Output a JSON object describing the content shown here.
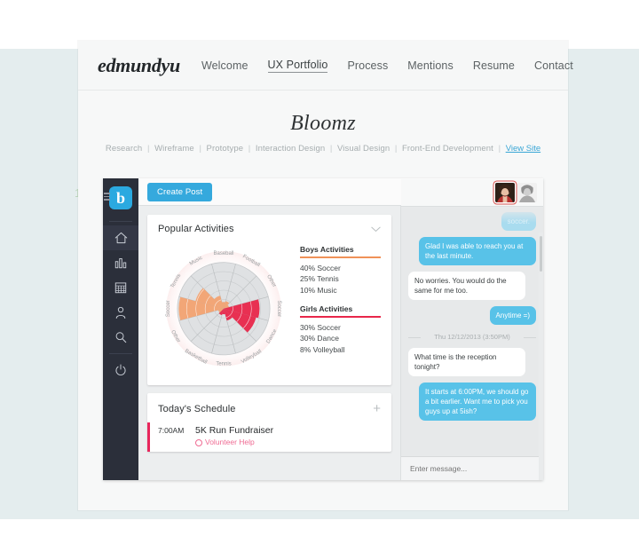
{
  "site": {
    "brand": "edmundyu",
    "nav": [
      {
        "label": "Welcome",
        "active": false
      },
      {
        "label": "UX Portfolio",
        "active": true
      },
      {
        "label": "Process",
        "active": false
      },
      {
        "label": "Mentions",
        "active": false
      },
      {
        "label": "Resume",
        "active": false
      },
      {
        "label": "Contact",
        "active": false
      }
    ]
  },
  "project": {
    "title": "Bloomz",
    "tags": [
      "Research",
      "Wireframe",
      "Prototype",
      "Interaction Design",
      "Visual Design",
      "Front-End Development"
    ],
    "separator": "|",
    "view_site_label": "View Site"
  },
  "marker": {
    "number": "1"
  },
  "app": {
    "sidebar": {
      "logo_letter": "b",
      "items": [
        {
          "icon": "home-icon",
          "selected": true
        },
        {
          "icon": "bar-chart-icon",
          "selected": false
        },
        {
          "icon": "calendar-icon",
          "selected": false
        },
        {
          "icon": "person-icon",
          "selected": false
        },
        {
          "icon": "search-icon",
          "selected": false
        },
        {
          "icon": "power-icon",
          "selected": false
        }
      ]
    },
    "toolbar": {
      "create_post_label": "Create Post"
    },
    "cards": {
      "activities": {
        "title": "Popular Activities",
        "collapse_icon": "chevron-down-icon",
        "boys": {
          "heading": "Boys Activities",
          "color": "#f09258",
          "items": [
            "40% Soccer",
            "25% Tennis",
            "10% Music"
          ]
        },
        "girls": {
          "heading": "Girls Activities",
          "color": "#e8264a",
          "items": [
            "30% Soccer",
            "30% Dance",
            "8% Volleyball"
          ]
        }
      },
      "schedule": {
        "title": "Today's Schedule",
        "add_icon": "plus-icon",
        "rows": [
          {
            "time": "7:00AM",
            "name": "5K Run Fundraiser",
            "sub": "Volunteer Help"
          }
        ]
      }
    },
    "chat": {
      "messages": [
        {
          "from": "me",
          "text": "soccer.",
          "faded": true
        },
        {
          "from": "me",
          "text": "Glad I was able to reach you at the last minute.",
          "faded": false
        },
        {
          "from": "them",
          "text": "No worries.  You would do the same for me too.",
          "faded": false
        },
        {
          "from": "me",
          "text": "Anytime =)",
          "faded": false
        },
        {
          "type": "timestamp",
          "text": "Thu 12/12/2013 (3:50PM)"
        },
        {
          "from": "them",
          "text": "What time is the reception tonight?",
          "faded": false
        },
        {
          "from": "me",
          "text": "It starts at 6:00PM, we should go a bit earlier. Want me to pick you guys up at 5ish?",
          "faded": false
        }
      ],
      "composer_placeholder": "Enter message..."
    }
  },
  "chart_data": {
    "type": "pie",
    "title": "Popular Activities",
    "subtype": "polar-rose",
    "legend_position": "right",
    "categories": [
      "Baseball",
      "Football",
      "Other",
      "Soccer",
      "Dance",
      "Volleyball",
      "Tennis",
      "Basketball",
      "Other",
      "Soccer",
      "Tennis",
      "Music"
    ],
    "series": [
      {
        "name": "Boys Activities",
        "color": "#f09258",
        "points": [
          {
            "label": "Soccer",
            "value": 40
          },
          {
            "label": "Tennis",
            "value": 25
          },
          {
            "label": "Music",
            "value": 10
          }
        ]
      },
      {
        "name": "Girls Activities",
        "color": "#e8264a",
        "points": [
          {
            "label": "Soccer",
            "value": 30
          },
          {
            "label": "Dance",
            "value": 30
          },
          {
            "label": "Volleyball",
            "value": 8
          }
        ]
      }
    ],
    "segment_values": [
      12,
      14,
      10,
      64,
      60,
      22,
      10,
      12,
      10,
      80,
      52,
      24
    ],
    "segment_colors": [
      "#f2a271",
      "#f2a271",
      "#f2a271",
      "#e8264a",
      "#e8264a",
      "#e8264a",
      "#e8264a",
      "#e8264a",
      "#f2a271",
      "#f2a271",
      "#f2a271",
      "#f2a271"
    ],
    "rings": 5,
    "grid": true
  }
}
